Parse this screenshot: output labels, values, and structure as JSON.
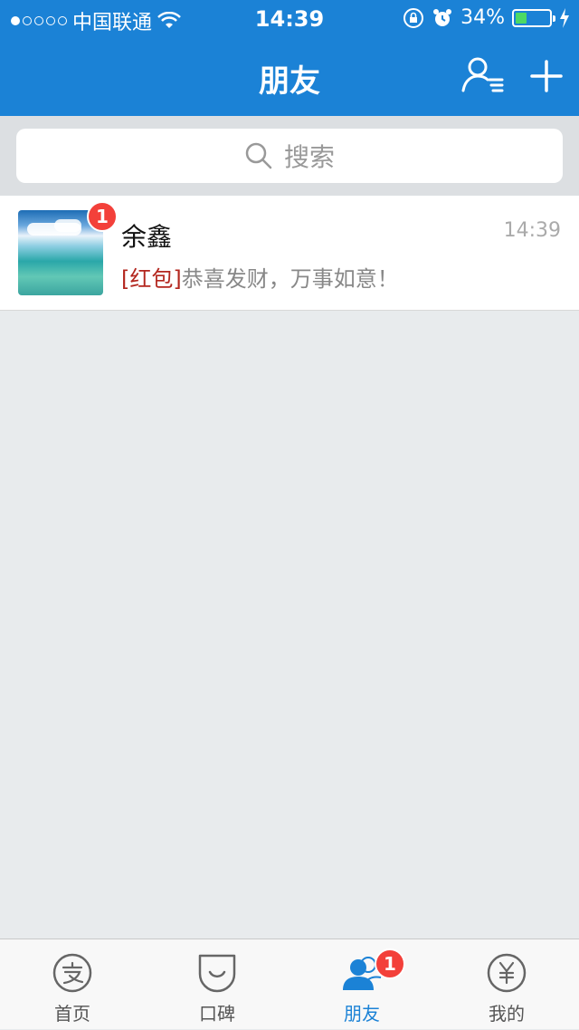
{
  "status_bar": {
    "carrier": "中国联通",
    "time": "14:39",
    "battery_percent": "34%",
    "battery_level": 0.34,
    "icons": [
      "signal-dots-icon",
      "wifi-icon",
      "rotation-lock-icon",
      "alarm-icon",
      "battery-icon",
      "charging-icon"
    ]
  },
  "nav": {
    "title": "朋友",
    "contacts_icon": "contacts-list-icon",
    "add_icon": "plus-icon"
  },
  "search": {
    "placeholder": "搜索",
    "icon": "search-icon"
  },
  "chats": [
    {
      "name": "余鑫",
      "time": "14:39",
      "unread": "1",
      "preview_tag": "[红包]",
      "preview_text": "恭喜发财，万事如意！"
    }
  ],
  "tabbar": {
    "tabs": [
      {
        "label": "首页",
        "icon": "alipay-icon",
        "active": false
      },
      {
        "label": "口碑",
        "icon": "koubei-icon",
        "active": false
      },
      {
        "label": "朋友",
        "icon": "friends-icon",
        "active": true,
        "badge": "1"
      },
      {
        "label": "我的",
        "icon": "wallet-yen-icon",
        "active": false
      }
    ]
  },
  "colors": {
    "brand_blue": "#1b82d6",
    "badge_red": "#f3403a",
    "red_packet_text": "#b3261e",
    "battery_green": "#4cd964"
  }
}
